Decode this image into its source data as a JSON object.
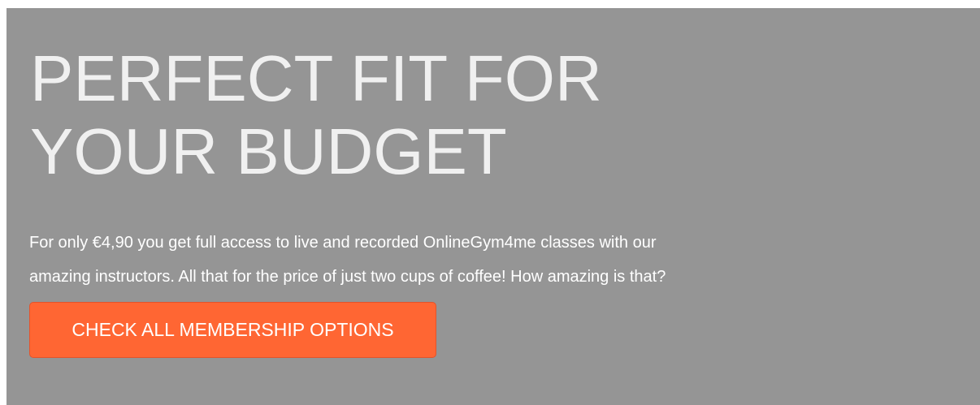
{
  "hero": {
    "title_line1": "PERFECT FIT FOR",
    "title_line2": "YOUR BUDGET",
    "description_line1": "For only €4,90 you get full access to live and recorded OnlineGym4me classes with our",
    "description_line2": "amazing instructors. All that for the price of just two cups of coffee! How amazing is that?",
    "cta_label": "CHECK ALL MEMBERSHIP OPTIONS"
  },
  "colors": {
    "panel_background": "#959595",
    "cta_background": "#ff6633",
    "title_text": "#f0f0f0",
    "body_text": "#ffffff"
  }
}
